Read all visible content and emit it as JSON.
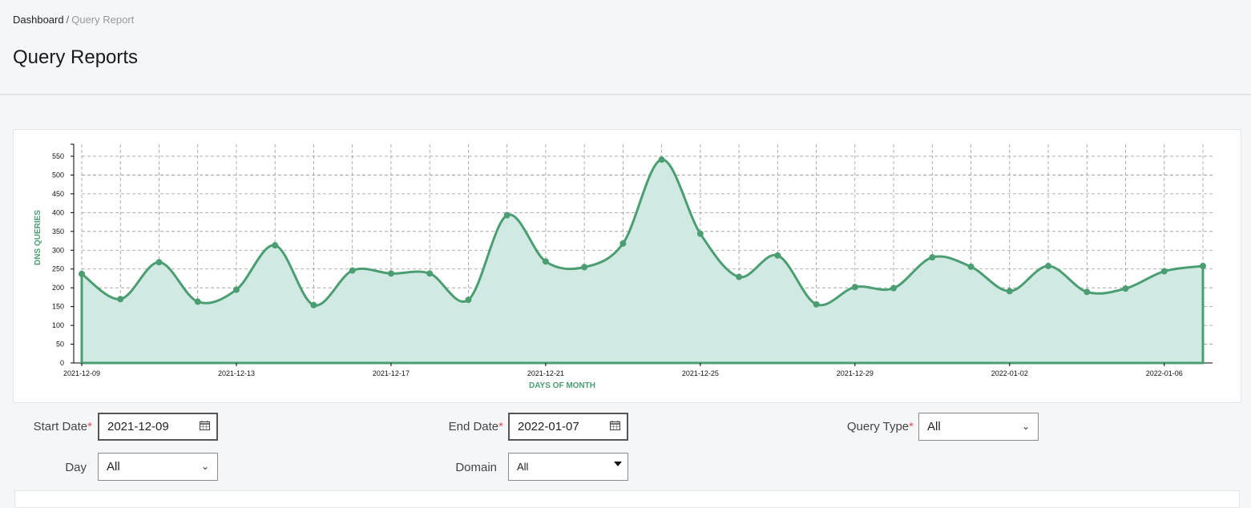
{
  "breadcrumb": {
    "home": "Dashboard",
    "separator": "/",
    "current": "Query Report"
  },
  "page": {
    "title": "Query Reports"
  },
  "form": {
    "start_date": {
      "label": "Start Date",
      "required": "*",
      "value": "2021-12-09"
    },
    "end_date": {
      "label": "End Date",
      "required": "*",
      "value": "2022-01-07"
    },
    "query_type": {
      "label": "Query Type",
      "required": "*",
      "value": "All"
    },
    "day": {
      "label": "Day",
      "value": "All"
    },
    "domain": {
      "label": "Domain",
      "value": "All"
    }
  },
  "colors": {
    "line": "#4a9e72",
    "fill": "#d0e9e3",
    "grid": "#999999",
    "axis_title": "#4a9e72"
  },
  "chart_data": {
    "type": "area",
    "xlabel": "DAYS OF MONTH",
    "ylabel": "DNS QUERIES",
    "ylim": [
      0,
      550
    ],
    "yticks": [
      0,
      50,
      100,
      150,
      200,
      250,
      300,
      350,
      400,
      450,
      500,
      550
    ],
    "x_tick_labels": [
      "2021-12-09",
      "2021-12-13",
      "2021-12-17",
      "2021-12-21",
      "2021-12-25",
      "2021-12-29",
      "2022-01-02",
      "2022-01-06"
    ],
    "grid": true,
    "x": [
      "2021-12-09",
      "2021-12-10",
      "2021-12-11",
      "2021-12-12",
      "2021-12-13",
      "2021-12-14",
      "2021-12-15",
      "2021-12-16",
      "2021-12-17",
      "2021-12-18",
      "2021-12-19",
      "2021-12-20",
      "2021-12-21",
      "2021-12-22",
      "2021-12-23",
      "2021-12-24",
      "2021-12-25",
      "2021-12-26",
      "2021-12-27",
      "2021-12-28",
      "2021-12-29",
      "2021-12-30",
      "2021-12-31",
      "2022-01-01",
      "2022-01-02",
      "2022-01-03",
      "2022-01-04",
      "2022-01-05",
      "2022-01-06",
      "2022-01-07"
    ],
    "values": [
      237,
      170,
      268,
      163,
      195,
      313,
      154,
      246,
      238,
      238,
      168,
      393,
      270,
      255,
      318,
      541,
      344,
      229,
      286,
      156,
      202,
      199,
      281,
      256,
      191,
      258,
      189,
      198,
      244,
      258
    ]
  }
}
